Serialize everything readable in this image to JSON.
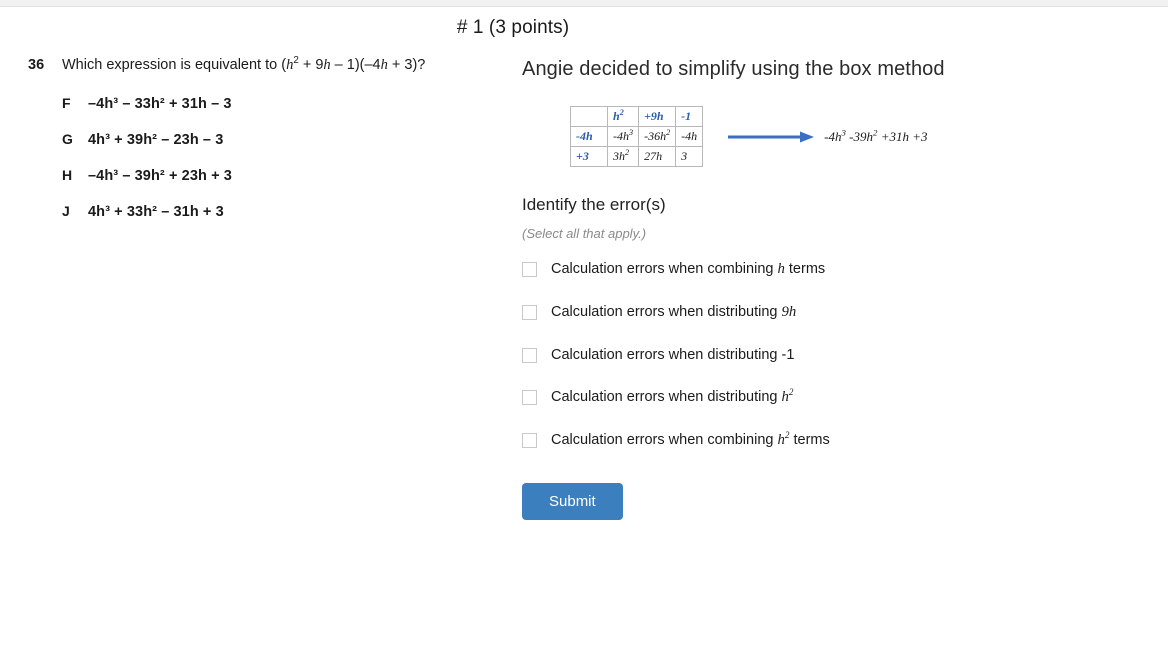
{
  "page": {
    "title": "# 1 (3 points)"
  },
  "question": {
    "number": "36",
    "stem_prefix": "Which expression is equivalent to (",
    "stem_expr_h": "h",
    "stem_expr_exp": "2",
    "stem_mid": " + 9",
    "stem_h2": "h",
    "stem_after": " – 1)(–4",
    "stem_h3": "h",
    "stem_end": " + 3)?",
    "choices": [
      {
        "letter": "F",
        "text": "–4h³ – 33h² + 31h – 3"
      },
      {
        "letter": "G",
        "text": "4h³ + 39h² – 23h – 3"
      },
      {
        "letter": "H",
        "text": "–4h³ – 39h² + 23h + 3"
      },
      {
        "letter": "J",
        "text": "4h³ + 33h² – 31h + 3"
      }
    ]
  },
  "scenario": {
    "heading": "Angie decided to simplify using the box method",
    "box_table": {
      "corner": "",
      "column_headers": [
        "h2",
        "+9h",
        "-1"
      ],
      "row_headers": [
        "-4h",
        "+3"
      ],
      "cells": [
        [
          "-4h3",
          "-36h2",
          "-4h"
        ],
        [
          "3h2",
          "27h",
          "3"
        ]
      ]
    },
    "arrow_color": "#3a6fc4",
    "result": "-4h3 -39h2 +31h +3"
  },
  "prompt": {
    "title": "Identify the error(s)",
    "subtitle": "(Select all that apply.)"
  },
  "options": [
    {
      "id": "combining-h",
      "prefix": "Calculation errors when combining ",
      "var": "h",
      "exp": "",
      "suffix": " terms"
    },
    {
      "id": "distributing-9h",
      "prefix": "Calculation errors when distributing ",
      "var": "9h",
      "exp": "",
      "suffix": ""
    },
    {
      "id": "distributing-neg1",
      "prefix": "Calculation errors when distributing -1",
      "var": "",
      "exp": "",
      "suffix": ""
    },
    {
      "id": "distributing-h2",
      "prefix": "Calculation errors when distributing ",
      "var": "h",
      "exp": "2",
      "suffix": ""
    },
    {
      "id": "combining-h2",
      "prefix": "Calculation errors when combining ",
      "var": "h",
      "exp": "2",
      "suffix": " terms"
    }
  ],
  "submit": {
    "label": "Submit",
    "color": "#3c7fbe"
  }
}
